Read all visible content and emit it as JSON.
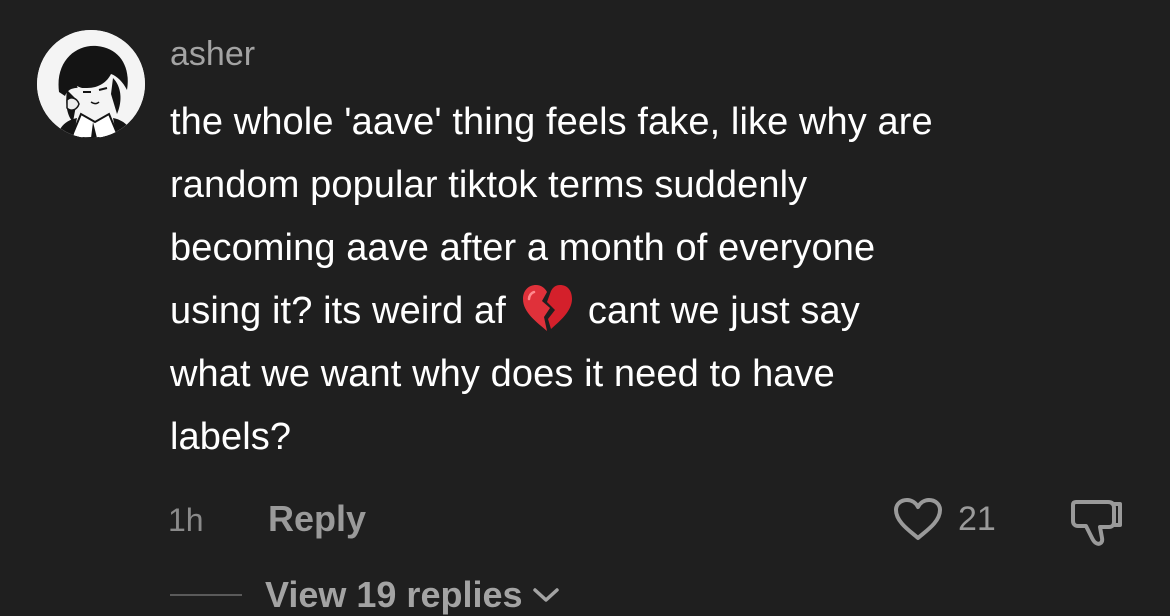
{
  "comment": {
    "username": "asher",
    "text_lines": [
      "the whole 'aave' thing feels fake, like why are",
      "random popular tiktok terms suddenly",
      "becoming aave after a month of everyone",
      "using it? its weird af",
      "cant we just say",
      "what we want why does it need to have",
      "labels?"
    ],
    "emoji": "broken-heart-icon",
    "timestamp": "1h",
    "reply_label": "Reply",
    "like_count": "21",
    "view_replies_label": "View 19 replies"
  },
  "icons": {
    "like": "heart-icon",
    "dislike": "thumbs-down-icon",
    "expand": "chevron-down-icon"
  },
  "colors": {
    "background": "#1f1f1f",
    "text_primary": "#ffffff",
    "text_secondary": "#a3a3a3",
    "emoji_red": "#e0313a"
  }
}
